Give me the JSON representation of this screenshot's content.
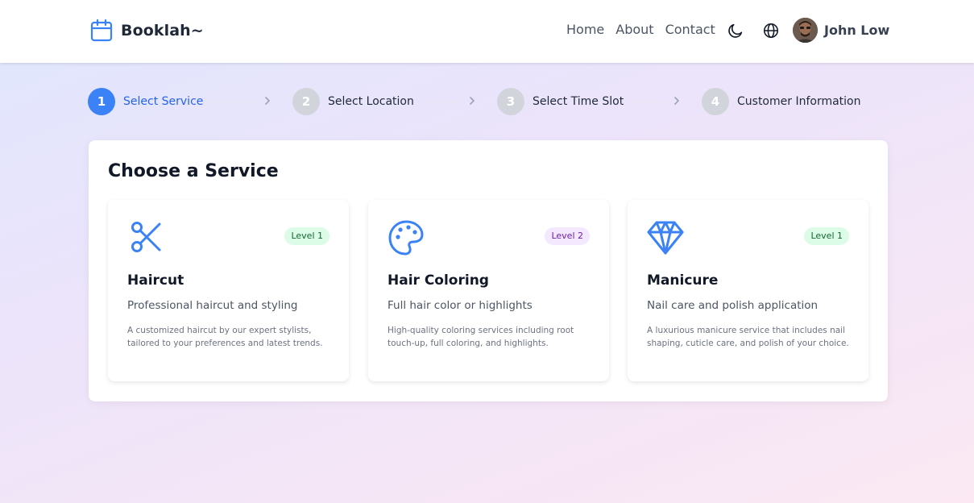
{
  "header": {
    "brand": "Booklah~",
    "nav": [
      "Home",
      "About",
      "Contact"
    ],
    "user_name": "John Low"
  },
  "stepper": {
    "steps": [
      {
        "number": "1",
        "label": "Select Service"
      },
      {
        "number": "2",
        "label": "Select Location"
      },
      {
        "number": "3",
        "label": "Select Time Slot"
      },
      {
        "number": "4",
        "label": "Customer Information"
      }
    ]
  },
  "main": {
    "title": "Choose a Service",
    "services": [
      {
        "icon": "scissors-icon",
        "level": "Level 1",
        "name": "Haircut",
        "short": "Professional haircut and styling",
        "description": "A customized haircut by our expert stylists, tailored to your preferences and latest trends."
      },
      {
        "icon": "palette-icon",
        "level": "Level 2",
        "name": "Hair Coloring",
        "short": "Full hair color or highlights",
        "description": "High-quality coloring services including root touch-up, full coloring, and highlights."
      },
      {
        "icon": "gem-icon",
        "level": "Level 1",
        "name": "Manicure",
        "short": "Nail care and polish application",
        "description": "A luxurious manicure service that includes nail shaping, cuticle care, and polish of your choice."
      }
    ]
  },
  "colors": {
    "accent": "#3b82f6",
    "level1_bg": "#dcfce7",
    "level2_bg": "#f3e8ff"
  }
}
